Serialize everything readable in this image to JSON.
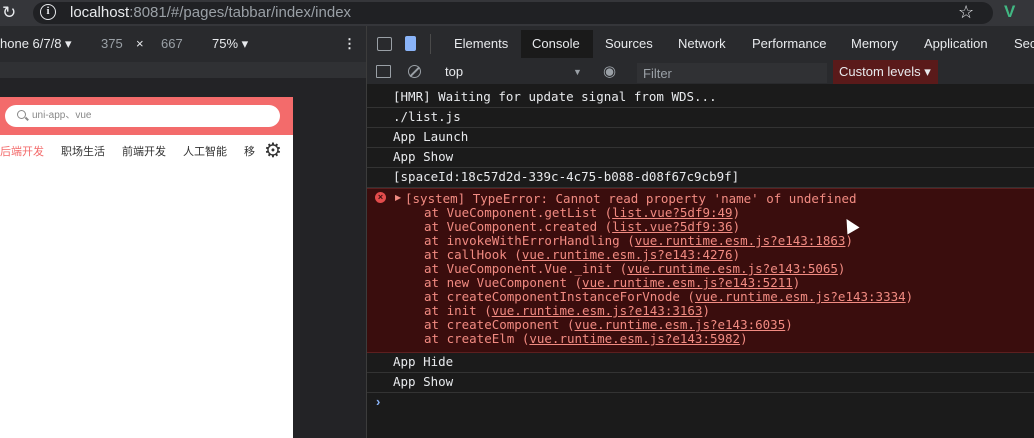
{
  "browser": {
    "url_host": "localhost",
    "url_rest": ":8081/#/pages/tabbar/index/index"
  },
  "device_toolbar": {
    "device": "hone 6/7/8 ▾",
    "width": "375",
    "times": "×",
    "height": "667",
    "zoom": "75% ▾",
    "more": "⋮"
  },
  "phone": {
    "search_placeholder": "uni-app、vue",
    "categories": [
      "后端开发",
      "职场生活",
      "前端开发",
      "人工智能",
      "移"
    ],
    "active_category": "后端开发"
  },
  "devtools": {
    "tabs": [
      "Elements",
      "Console",
      "Sources",
      "Network",
      "Performance",
      "Memory",
      "Application",
      "Sec"
    ],
    "active_tab": "Console",
    "context": "top",
    "filter_placeholder": "Filter",
    "levels": "Custom levels ▾"
  },
  "console": {
    "logs_before": [
      "[HMR] Waiting for update signal from WDS...",
      "./list.js",
      "App Launch",
      "App Show",
      "[spaceId:18c57d2d-339c-4c75-b088-d08f67c9cb9f]"
    ],
    "error": {
      "message": "[system] TypeError: Cannot read property 'name' of undefined",
      "frames": [
        {
          "fn": "at VueComponent.getList (",
          "loc": "list.vue?5df9:49",
          "end": ")"
        },
        {
          "fn": "at VueComponent.created (",
          "loc": "list.vue?5df9:36",
          "end": ")"
        },
        {
          "fn": "at invokeWithErrorHandling (",
          "loc": "vue.runtime.esm.js?e143:1863",
          "end": ")"
        },
        {
          "fn": "at callHook (",
          "loc": "vue.runtime.esm.js?e143:4276",
          "end": ")"
        },
        {
          "fn": "at VueComponent.Vue._init (",
          "loc": "vue.runtime.esm.js?e143:5065",
          "end": ")"
        },
        {
          "fn": "at new VueComponent (",
          "loc": "vue.runtime.esm.js?e143:5211",
          "end": ")"
        },
        {
          "fn": "at createComponentInstanceForVnode (",
          "loc": "vue.runtime.esm.js?e143:3334",
          "end": ")"
        },
        {
          "fn": "at init (",
          "loc": "vue.runtime.esm.js?e143:3163",
          "end": ")"
        },
        {
          "fn": "at createComponent (",
          "loc": "vue.runtime.esm.js?e143:6035",
          "end": ")"
        },
        {
          "fn": "at createElm (",
          "loc": "vue.runtime.esm.js?e143:5982",
          "end": ")"
        }
      ]
    },
    "logs_after": [
      "App Hide",
      "App Show"
    ],
    "prompt": "›"
  },
  "icons": [
    "reload-icon",
    "info-icon",
    "star-icon",
    "vue-devtools-icon",
    "inspect-icon",
    "device-toggle-icon",
    "sidebar-icon",
    "clear-icon",
    "eye-icon",
    "error-icon",
    "gear-icon",
    "search-icon"
  ],
  "colors": {
    "phone_header": "#f36b6b",
    "error_text": "#f28b82",
    "error_bg": "#3a0d0d",
    "vue": "#41b883"
  }
}
